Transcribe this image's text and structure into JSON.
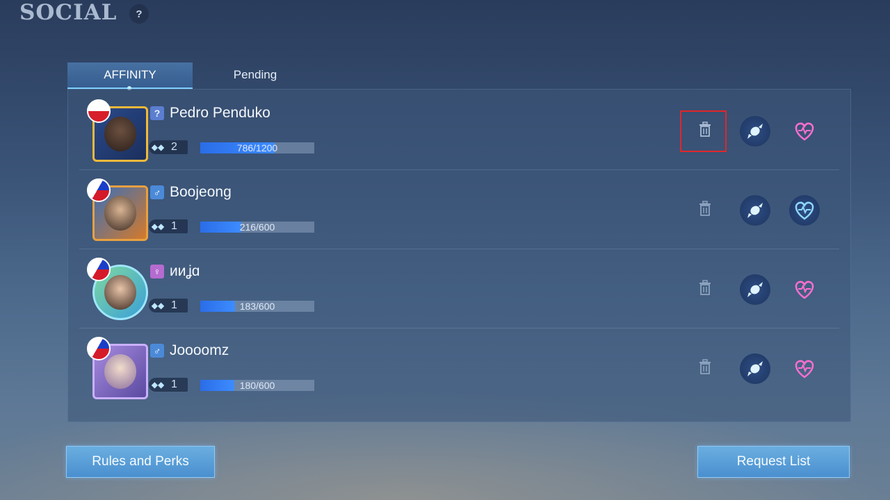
{
  "header": {
    "title": "SOCIAL",
    "help_glyph": "?"
  },
  "tabs": [
    {
      "label": "AFFINITY",
      "active": true
    },
    {
      "label": "Pending",
      "active": false
    }
  ],
  "friends": [
    {
      "name": "Pedro Penduko",
      "flag": "poland-flag",
      "gender": "unknown",
      "gender_glyph": "?",
      "level": "2",
      "progress_text": "786/1200",
      "progress": 0.655,
      "heart_color": "pink",
      "delete_highlighted": true
    },
    {
      "name": "Boojeong",
      "flag": "philippines-flag",
      "gender": "male",
      "gender_glyph": "♂",
      "level": "1",
      "progress_text": "216/600",
      "progress": 0.36,
      "heart_color": "blue",
      "delete_highlighted": false
    },
    {
      "name": "ᴎᴎʝɑ",
      "flag": "philippines-flag",
      "gender": "female",
      "gender_glyph": "♀",
      "level": "1",
      "progress_text": "183/600",
      "progress": 0.305,
      "heart_color": "pink",
      "delete_highlighted": false
    },
    {
      "name": "Joooomz",
      "flag": "philippines-flag",
      "gender": "male",
      "gender_glyph": "♂",
      "level": "1",
      "progress_text": "180/600",
      "progress": 0.3,
      "heart_color": "pink",
      "delete_highlighted": false
    }
  ],
  "buttons": {
    "rules": "Rules and Perks",
    "request": "Request List"
  },
  "colors": {
    "accent": "#3d8cff",
    "heart_pink": "#ff6fd0",
    "heart_blue": "#8fd8ff",
    "highlight": "#e0262b"
  }
}
